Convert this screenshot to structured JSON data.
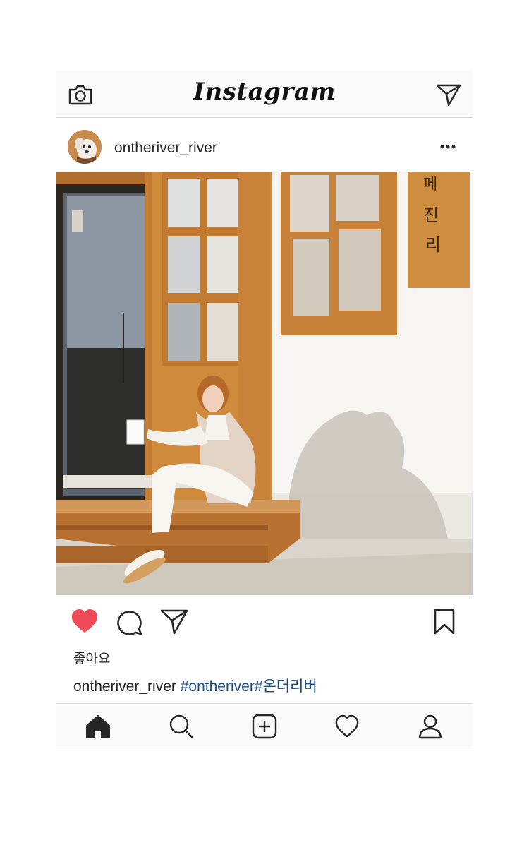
{
  "header": {
    "logo_text": "Instagram",
    "camera_icon": "camera-icon",
    "direct_icon": "paper-plane-icon"
  },
  "post": {
    "username": "ontheriver_river",
    "more_icon": "more-dots-icon",
    "photo_sign_text": "페 진 리",
    "actions": {
      "like_icon": "heart-filled-icon",
      "comment_icon": "comment-icon",
      "share_icon": "paper-plane-icon",
      "save_icon": "bookmark-icon",
      "like_color": "#ed4956"
    },
    "likes_label": "좋아요",
    "caption": {
      "username": "ontheriver_river",
      "hashtags": "#ontheriver#온더리버"
    }
  },
  "tabbar": {
    "tabs": [
      {
        "name": "home",
        "icon": "home-icon",
        "active": true
      },
      {
        "name": "search",
        "icon": "search-icon",
        "active": false
      },
      {
        "name": "add",
        "icon": "add-post-icon",
        "active": false
      },
      {
        "name": "activity",
        "icon": "heart-icon",
        "active": false
      },
      {
        "name": "profile",
        "icon": "profile-icon",
        "active": false
      }
    ]
  },
  "colors": {
    "hashtag": "#1b4e84",
    "bar_background": "#fafafa",
    "divider": "#d9d9d9"
  }
}
